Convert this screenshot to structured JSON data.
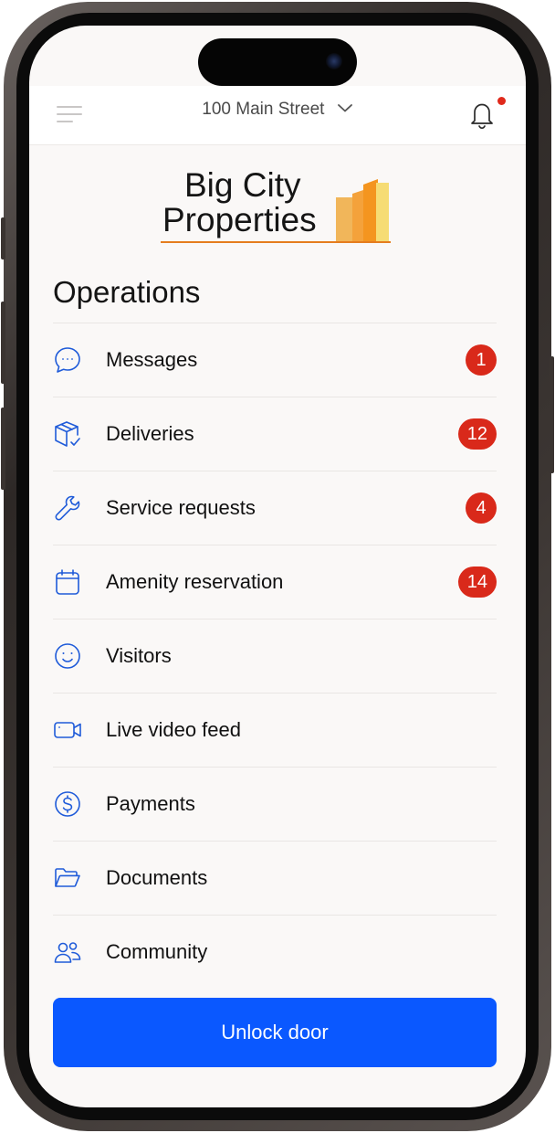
{
  "header": {
    "address": "100 Main Street"
  },
  "logo": {
    "line1": "Big City",
    "line2": "Properties"
  },
  "section_title": "Operations",
  "items": [
    {
      "label": "Messages",
      "icon": "chat-bubble-icon",
      "badge": "1"
    },
    {
      "label": "Deliveries",
      "icon": "package-icon",
      "badge": "12"
    },
    {
      "label": "Service requests",
      "icon": "wrench-icon",
      "badge": "4"
    },
    {
      "label": "Amenity reservation",
      "icon": "calendar-icon",
      "badge": "14"
    },
    {
      "label": "Visitors",
      "icon": "smiley-icon"
    },
    {
      "label": "Live video feed",
      "icon": "video-camera-icon"
    },
    {
      "label": "Payments",
      "icon": "dollar-circle-icon"
    },
    {
      "label": "Documents",
      "icon": "folder-icon"
    },
    {
      "label": "Community",
      "icon": "people-icon"
    }
  ],
  "cta_label": "Unlock door",
  "colors": {
    "accent": "#0a58ff",
    "badge": "#d9291a",
    "icon": "#1f5bd9",
    "logo_orange": "#e57d1f",
    "background": "#faf8f7"
  }
}
